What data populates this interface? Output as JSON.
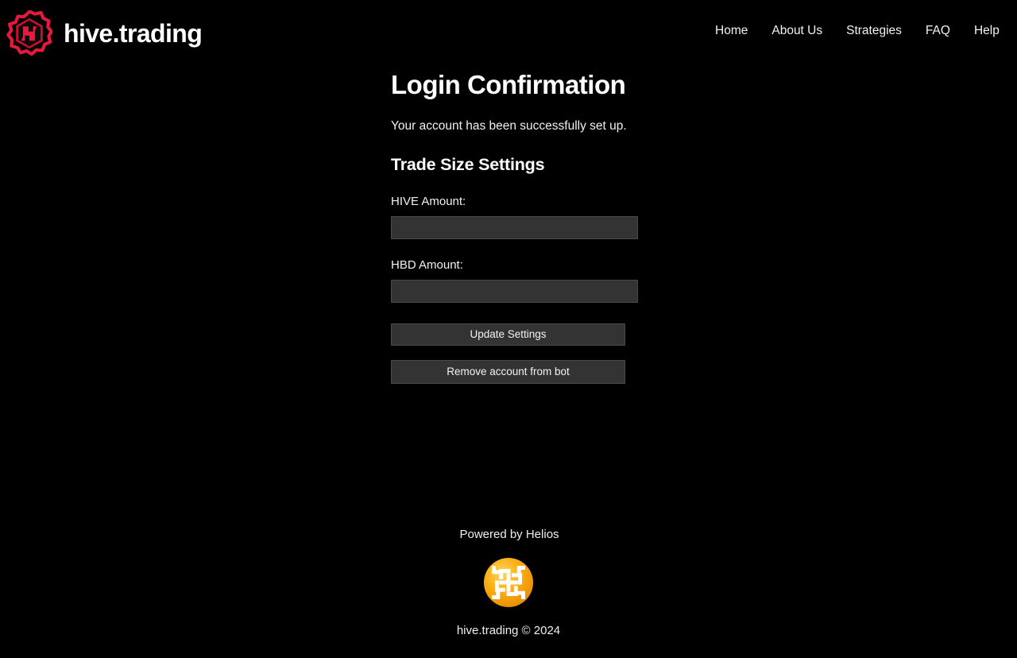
{
  "brand": {
    "wordmark": "hive.trading",
    "logo_icon": "hive-hexagon-logo-icon",
    "logo_color": "#e8193c"
  },
  "nav": {
    "items": [
      {
        "label": "Home"
      },
      {
        "label": "About Us"
      },
      {
        "label": "Strategies"
      },
      {
        "label": "FAQ"
      },
      {
        "label": "Help"
      }
    ]
  },
  "main": {
    "title": "Login Confirmation",
    "subtitle": "Your account has been successfully set up.",
    "section_title": "Trade Size Settings",
    "fields": [
      {
        "label": "HIVE Amount:",
        "value": "",
        "placeholder": ""
      },
      {
        "label": "HBD Amount:",
        "value": "",
        "placeholder": ""
      }
    ],
    "buttons": {
      "update": "Update Settings",
      "remove": "Remove account from bot"
    }
  },
  "footer": {
    "powered_by": "Powered by Helios",
    "helios_icon": "helios-sun-logo-icon",
    "helios_color": "#f7a800",
    "copyright": "hive.trading © 2024"
  },
  "theme": {
    "background": "#000000",
    "text": "#ffffff",
    "field_background": "#333333",
    "field_border": "#4a4a4a"
  }
}
